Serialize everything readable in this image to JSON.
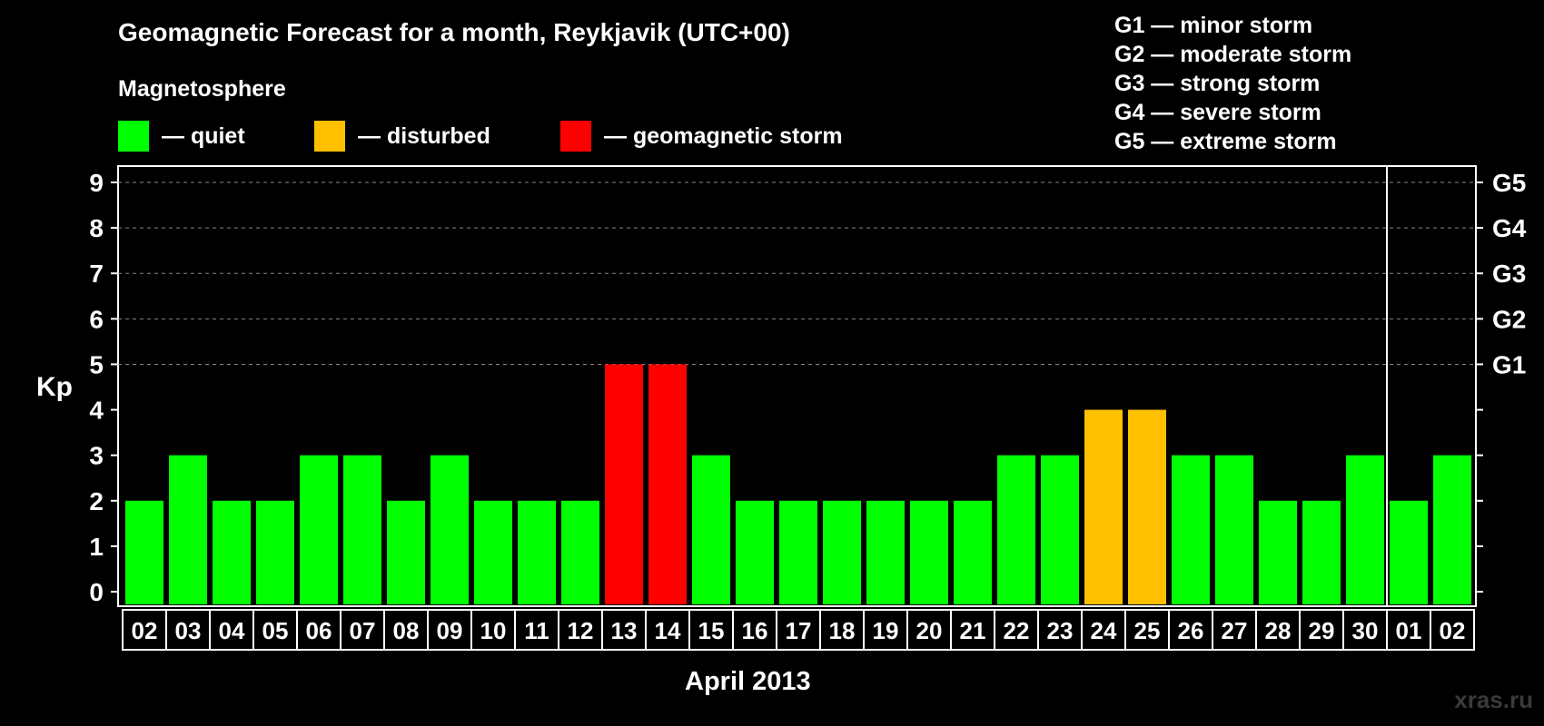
{
  "header": {
    "title": "Geomagnetic Forecast for a month, Reykjavik (UTC+00)",
    "subtitle": "Magnetosphere"
  },
  "legend": [
    {
      "label": "— quiet",
      "color": "#00ff00"
    },
    {
      "label": "— disturbed",
      "color": "#ffc000"
    },
    {
      "label": "— geomagnetic storm",
      "color": "#ff0000"
    }
  ],
  "storm_scale": [
    "G1 — minor storm",
    "G2 — moderate storm",
    "G3 — strong storm",
    "G4 — severe storm",
    "G5 — extreme storm"
  ],
  "watermark": "xras.ru",
  "chart_data": {
    "type": "bar",
    "title": "Geomagnetic Forecast for a month, Reykjavik (UTC+00)",
    "xlabel": "April 2013",
    "ylabel": "Kp",
    "ylim": [
      0,
      9
    ],
    "yticks": [
      "0",
      "1",
      "2",
      "3",
      "4",
      "5",
      "6",
      "7",
      "8",
      "9"
    ],
    "right_ticks": [
      {
        "value": 5,
        "label": "G1"
      },
      {
        "value": 6,
        "label": "G2"
      },
      {
        "value": 7,
        "label": "G3"
      },
      {
        "value": 8,
        "label": "G4"
      },
      {
        "value": 9,
        "label": "G5"
      }
    ],
    "grid": "dashed horizontal at 5–9",
    "categories": [
      "02",
      "03",
      "04",
      "05",
      "06",
      "07",
      "08",
      "09",
      "10",
      "11",
      "12",
      "13",
      "14",
      "15",
      "16",
      "17",
      "18",
      "19",
      "20",
      "21",
      "22",
      "23",
      "24",
      "25",
      "26",
      "27",
      "28",
      "29",
      "30",
      "01",
      "02"
    ],
    "values": [
      2,
      3,
      2,
      2,
      3,
      3,
      2,
      3,
      2,
      2,
      2,
      5,
      5,
      3,
      2,
      2,
      2,
      2,
      2,
      2,
      3,
      3,
      4,
      4,
      3,
      3,
      2,
      2,
      3,
      2,
      3
    ],
    "colors": {
      "quiet": "#00ff00",
      "disturbed": "#ffc000",
      "storm": "#ff0000"
    },
    "month_divider_after": "30"
  }
}
